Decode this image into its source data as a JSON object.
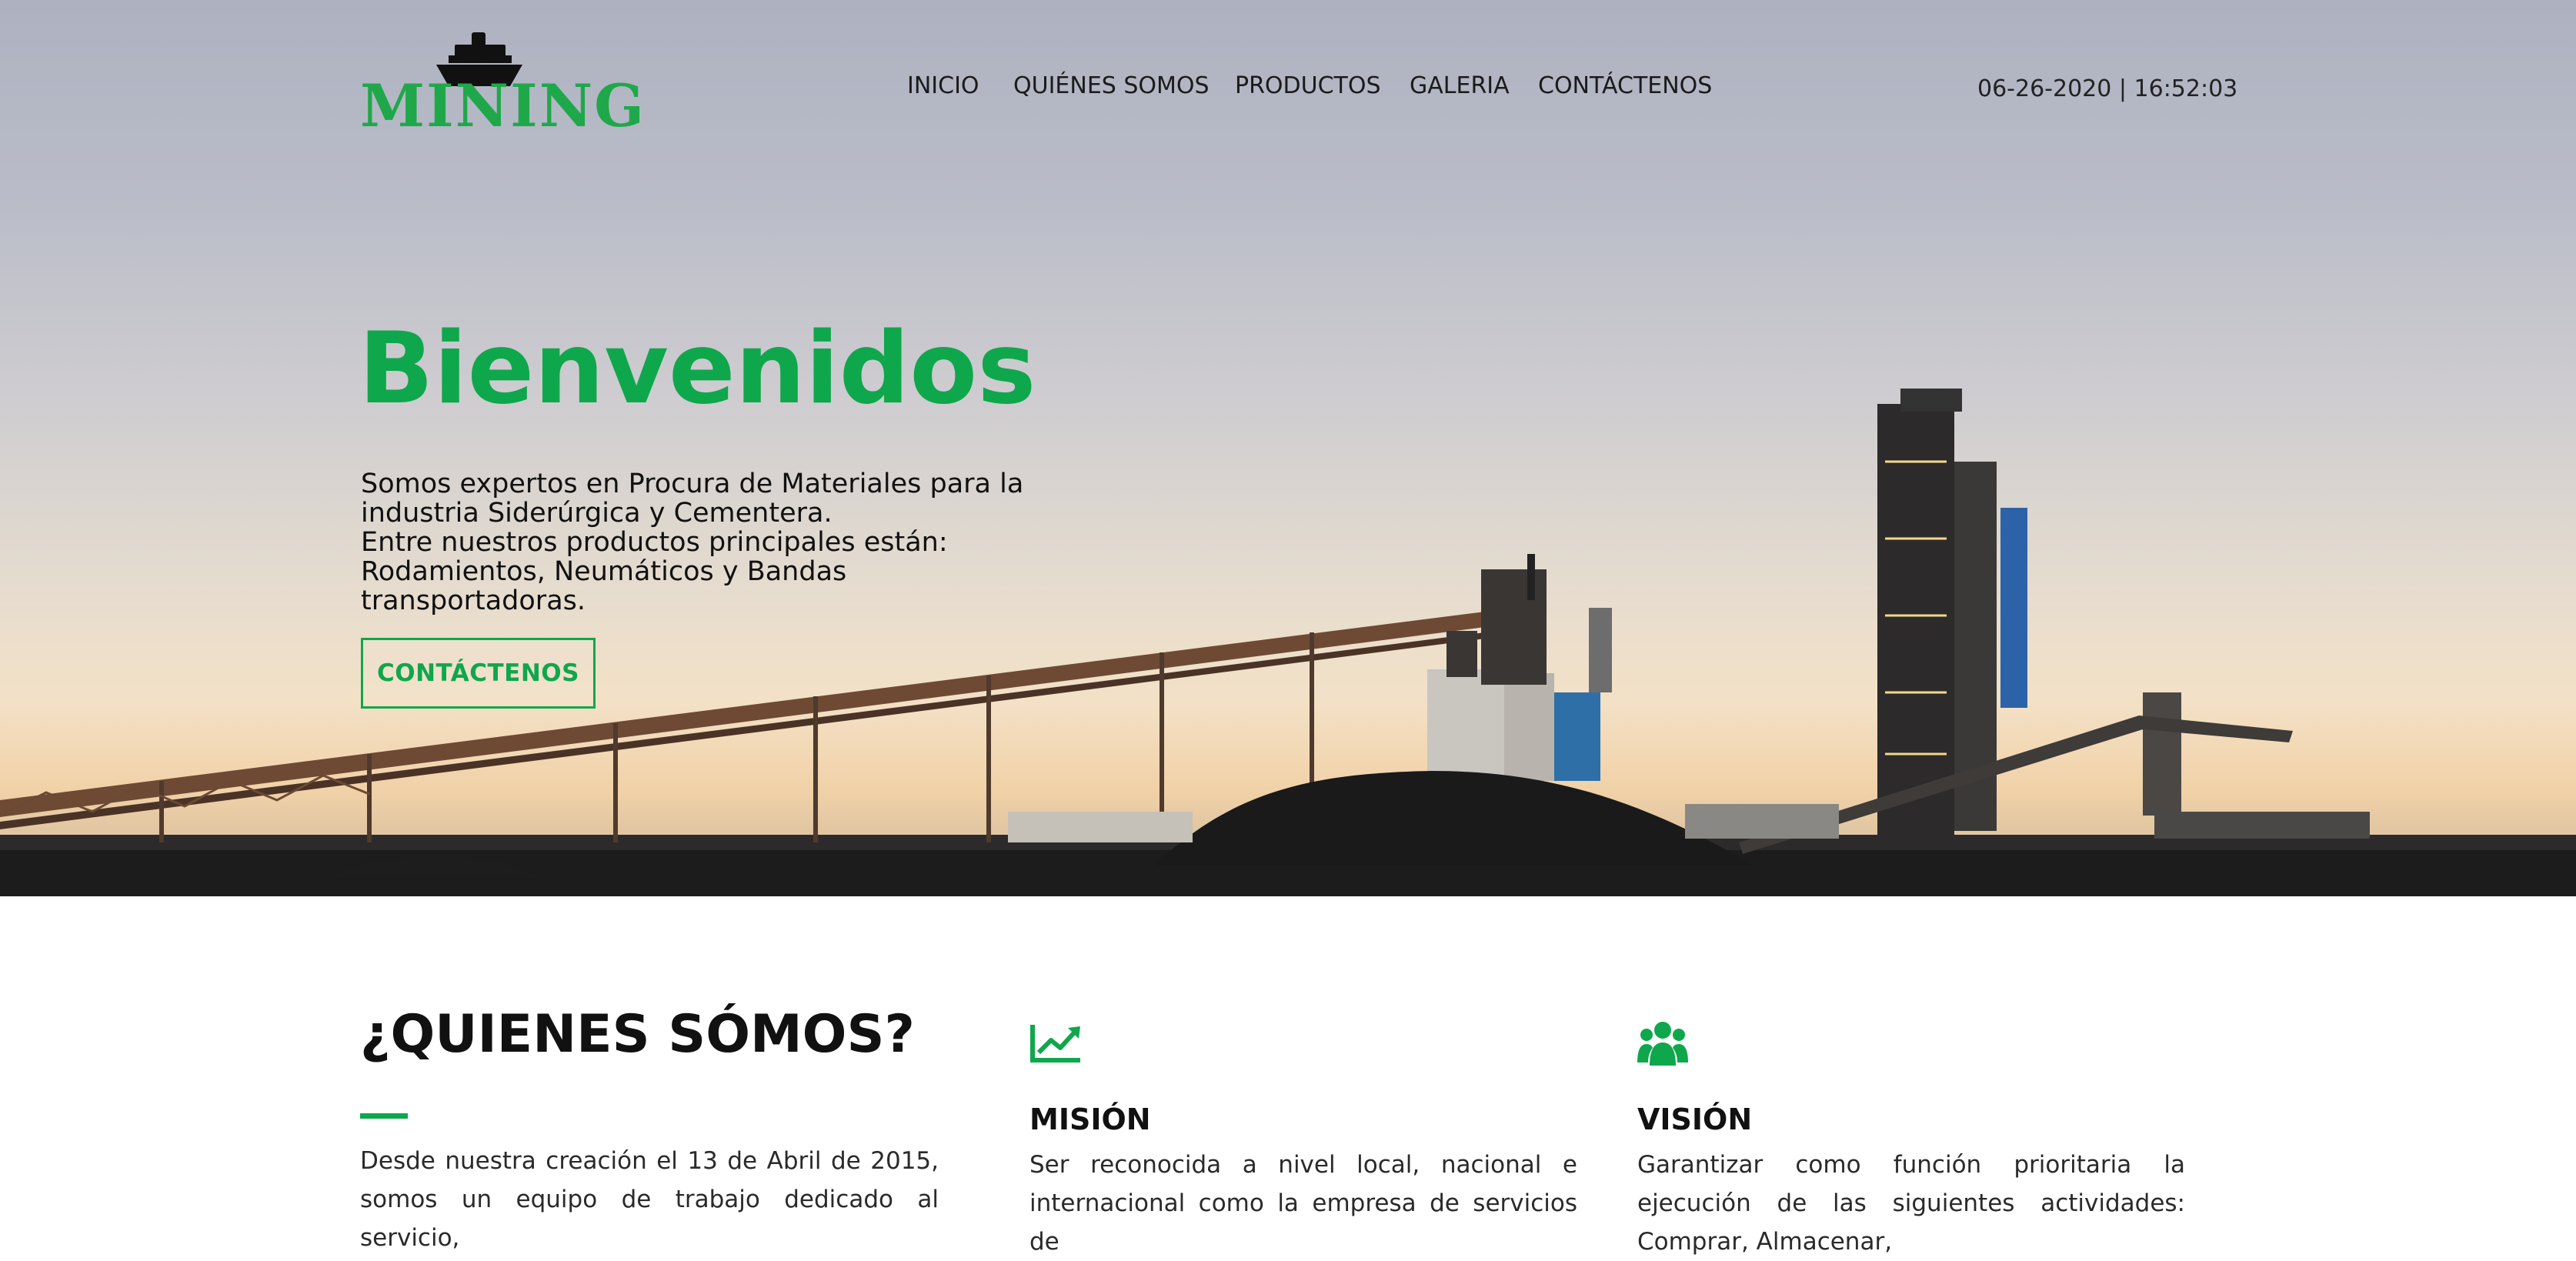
{
  "header": {
    "logo_text": "MINING",
    "nav": [
      {
        "label": "INICIO"
      },
      {
        "label": "QUIÉNES SOMOS"
      },
      {
        "label": "PRODUCTOS"
      },
      {
        "label": "GALERIA"
      },
      {
        "label": "CONTÁCTENOS"
      }
    ],
    "datetime": "06-26-2020 | 16:52:03"
  },
  "hero": {
    "title": "Bienvenidos",
    "lines": [
      "Somos expertos en Procura de Materiales para la",
      "industria Siderúrgica y Cementera.",
      "Entre nuestros productos principales están:",
      "Rodamientos, Neumáticos y Bandas",
      "transportadoras."
    ],
    "cta_label": "CONTÁCTENOS"
  },
  "about": {
    "title": "¿QUIENES SÓMOS?",
    "text": "Desde nuestra creación el 13 de Abril de 2015, somos un equipo de trabajo dedicado al servicio,"
  },
  "mission": {
    "icon": "chart-line-icon",
    "heading": "MISIÓN",
    "text": "Ser reconocida a nivel local, nacional e internacional como la empresa de servicios de"
  },
  "vision": {
    "icon": "users-icon",
    "heading": "VISIÓN",
    "text": "Garantizar como función prioritaria la ejecución de las siguientes actividades: Comprar, Almacenar,"
  },
  "colors": {
    "accent": "#0fa74c",
    "logo": "#1fa84a"
  }
}
